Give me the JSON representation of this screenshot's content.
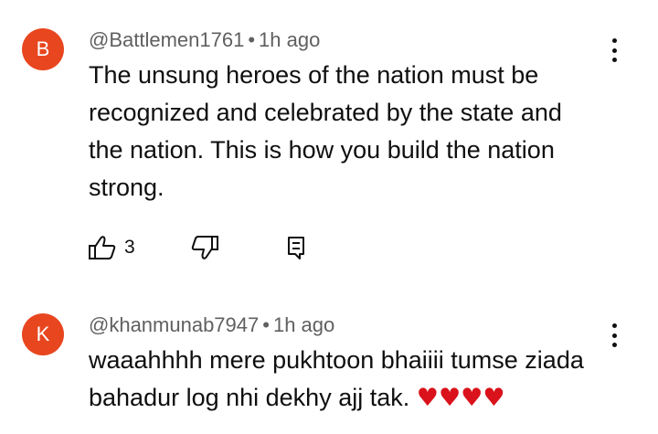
{
  "comments": [
    {
      "avatar_letter": "B",
      "avatar_color": "#e8461f",
      "handle": "@Battlemen1761",
      "separator": "•",
      "time": "1h ago",
      "text": "The unsung heroes of the nation must be recognized and celebrated by the state and the nation. This is how you build the nation strong.",
      "like_count": "3",
      "icons": [
        "thumbs-up-icon",
        "thumbs-down-icon",
        "reply-icon",
        "more-vert-icon"
      ]
    },
    {
      "avatar_letter": "K",
      "avatar_color": "#e8461f",
      "handle": "@khanmunab7947",
      "separator": "•",
      "time": "1h ago",
      "text_line1": "waaahhhh mere pukhtoon bhaiiii tumse ziada",
      "text_line2": "bahadur log nhi dekhy ajj tak.",
      "emoji": "♥♥♥♥",
      "icons": [
        "more-vert-icon"
      ]
    }
  ]
}
